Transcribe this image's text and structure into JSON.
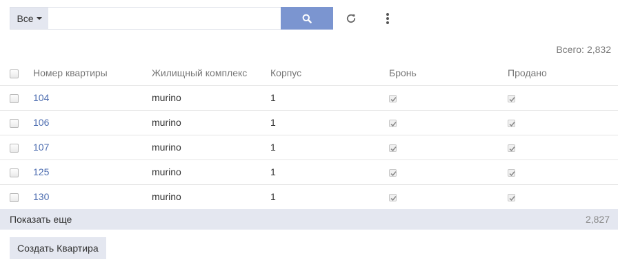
{
  "toolbar": {
    "filter_label": "Все",
    "search_placeholder": "",
    "search_value": ""
  },
  "summary": {
    "total_label": "Всего:",
    "total_value": "2,832"
  },
  "table": {
    "columns": [
      "Номер квартиры",
      "Жилищный комплекс",
      "Корпус",
      "Бронь",
      "Продано"
    ],
    "rows": [
      {
        "number": "104",
        "complex": "murino",
        "building": "1",
        "reserved": true,
        "sold": true
      },
      {
        "number": "106",
        "complex": "murino",
        "building": "1",
        "reserved": true,
        "sold": true
      },
      {
        "number": "107",
        "complex": "murino",
        "building": "1",
        "reserved": true,
        "sold": true
      },
      {
        "number": "125",
        "complex": "murino",
        "building": "1",
        "reserved": true,
        "sold": true
      },
      {
        "number": "130",
        "complex": "murino",
        "building": "1",
        "reserved": true,
        "sold": true
      }
    ]
  },
  "show_more": {
    "label": "Показать еще",
    "remaining": "2,827"
  },
  "create_button_label": "Создать Квартира",
  "icons": {
    "search": "search-icon",
    "refresh": "refresh-icon",
    "more": "more-vertical-icon"
  },
  "colors": {
    "accent": "#7b95d0",
    "link": "#4d6db0",
    "panel": "#e4e7f0"
  }
}
